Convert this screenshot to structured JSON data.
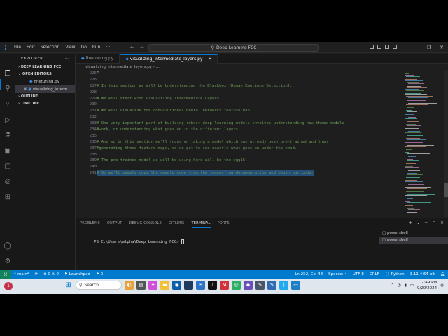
{
  "titlebar": {
    "menu": [
      "File",
      "Edit",
      "Selection",
      "View",
      "Go",
      "Run"
    ],
    "more": "···",
    "search_text": "Deep Learning FCC"
  },
  "sidebar": {
    "header": "EXPLORER",
    "header_more": "···",
    "folder": "DEEP LEARNING FCC",
    "open_editors": "OPEN EDITORS",
    "open_files": [
      {
        "name": "finetuning.py",
        "selected": false
      },
      {
        "name": "visualizing_interm...",
        "selected": true
      }
    ],
    "outline": "OUTLINE",
    "timeline": "TIMELINE"
  },
  "tabs": [
    {
      "label": "finetuning.py",
      "active": false
    },
    {
      "label": "visualizing_intermediate_layers.py",
      "active": true
    }
  ],
  "breadcrumb": "visualizing_intermediate_layers.py › ...",
  "editor": {
    "lines": [
      {
        "n": "225",
        "text": "\"",
        "type": "plain"
      },
      {
        "n": "226",
        "text": "",
        "type": "plain"
      },
      {
        "n": "227",
        "text": "# In this section we will be Understanding the Blackbox [Human Emotions Detection].",
        "type": "comment"
      },
      {
        "n": "228",
        "text": "",
        "type": "plain"
      },
      {
        "n": "229",
        "text": "# We will start with Visualizing Intermediate Layers.",
        "type": "comment"
      },
      {
        "n": "230",
        "text": "",
        "type": "plain"
      },
      {
        "n": "231",
        "text": "# We will visualize the convolutional neural networks feature map.",
        "type": "comment"
      },
      {
        "n": "232",
        "text": "",
        "type": "plain"
      },
      {
        "n": "233",
        "text": "# One very important part of building robust deep learning models involves understanding how these models",
        "type": "comment"
      },
      {
        "n": "234",
        "text": "#work, or understanding what goes on in the different layers.",
        "type": "comment"
      },
      {
        "n": "235",
        "text": "",
        "type": "plain"
      },
      {
        "n": "236",
        "text": "# And so in this section we'll focus on taking a model which has already been pre-trained and then",
        "type": "comment"
      },
      {
        "n": "237",
        "text": "#generating these feature maps, so we get to see exactly what goes on under the hood.",
        "type": "comment"
      },
      {
        "n": "238",
        "text": "",
        "type": "plain"
      },
      {
        "n": "239",
        "text": "# The pre-trained model we will be using here will be the vgg16.",
        "type": "comment"
      },
      {
        "n": "240",
        "text": "",
        "type": "plain"
      },
      {
        "n": "241",
        "text": "# So we'll simply copy the sample code from the tensorflow documentation and begin our code.",
        "type": "selected"
      }
    ]
  },
  "panel": {
    "tabs": [
      "PROBLEMS",
      "OUTPUT",
      "DEBUG CONSOLE",
      "GITLENS",
      "TERMINAL",
      "PORTS"
    ],
    "active_tab": "TERMINAL",
    "icons": [
      "+",
      "⌄",
      "···",
      "⌃",
      "×"
    ],
    "terminal_prompt": "PS C:\\Users\\alpha\\Deep Learning FCC> ",
    "terminals": [
      {
        "name": "powershell",
        "active": false
      },
      {
        "name": "powershell",
        "active": true
      }
    ]
  },
  "statusbar": {
    "branch": "main*",
    "sync": "⟳",
    "errors": "⊗ 0 ⚠ 0",
    "launchpad": "Launchpad",
    "ports": "⚑ 0",
    "position": "Ln 252, Col 48",
    "spaces": "Spaces: 4",
    "encoding": "UTF-8",
    "eol": "CRLF",
    "language": "Python",
    "interpreter": "3.11.4 64-bit"
  },
  "taskbar": {
    "search_placeholder": "Search",
    "weather_badge": "1",
    "clock_time": "2:49 PM",
    "clock_date": "9/20/2024"
  }
}
